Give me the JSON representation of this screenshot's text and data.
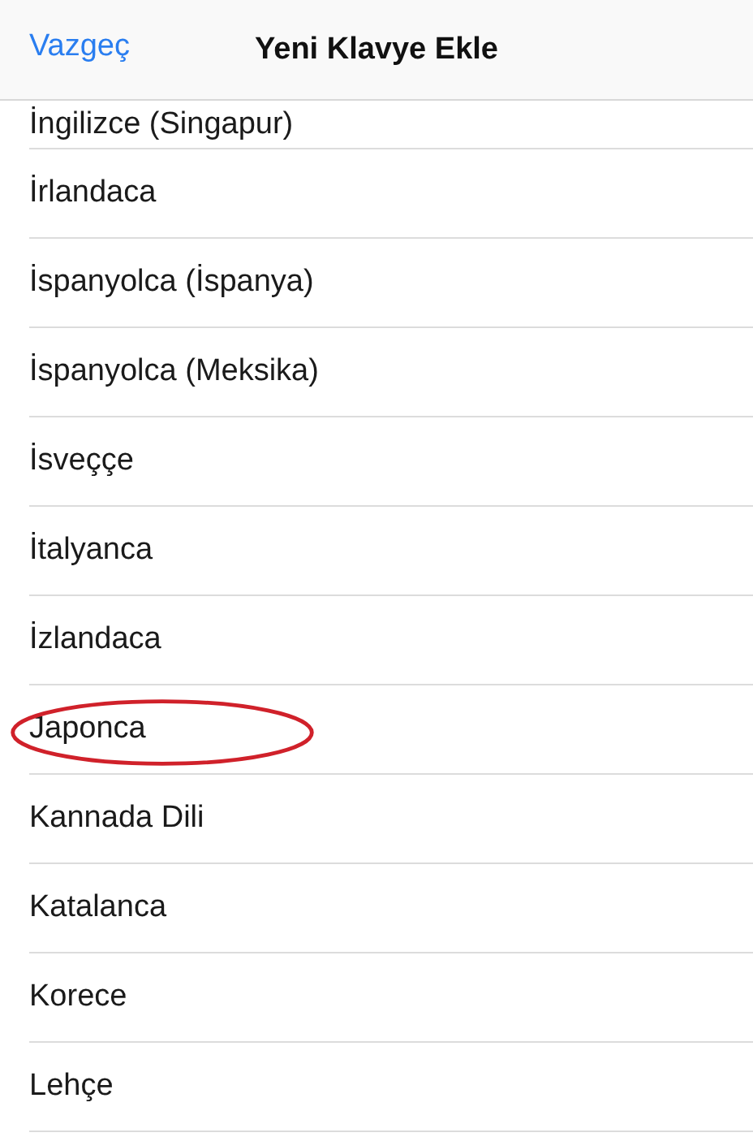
{
  "nav_bar": {
    "cancel": "Vazgeç",
    "title": "Yeni Klavye Ekle"
  },
  "languages": [
    {
      "label": "İngilizce (Singapur)",
      "highlighted": false
    },
    {
      "label": "İrlandaca",
      "highlighted": false
    },
    {
      "label": "İspanyolca (İspanya)",
      "highlighted": false
    },
    {
      "label": "İspanyolca (Meksika)",
      "highlighted": false
    },
    {
      "label": "İsveççe",
      "highlighted": false
    },
    {
      "label": "İtalyanca",
      "highlighted": false
    },
    {
      "label": "İzlandaca",
      "highlighted": false
    },
    {
      "label": "Japonca",
      "highlighted": true
    },
    {
      "label": "Kannada Dili",
      "highlighted": false
    },
    {
      "label": "Katalanca",
      "highlighted": false
    },
    {
      "label": "Korece",
      "highlighted": false
    },
    {
      "label": "Lehçe",
      "highlighted": false
    }
  ]
}
